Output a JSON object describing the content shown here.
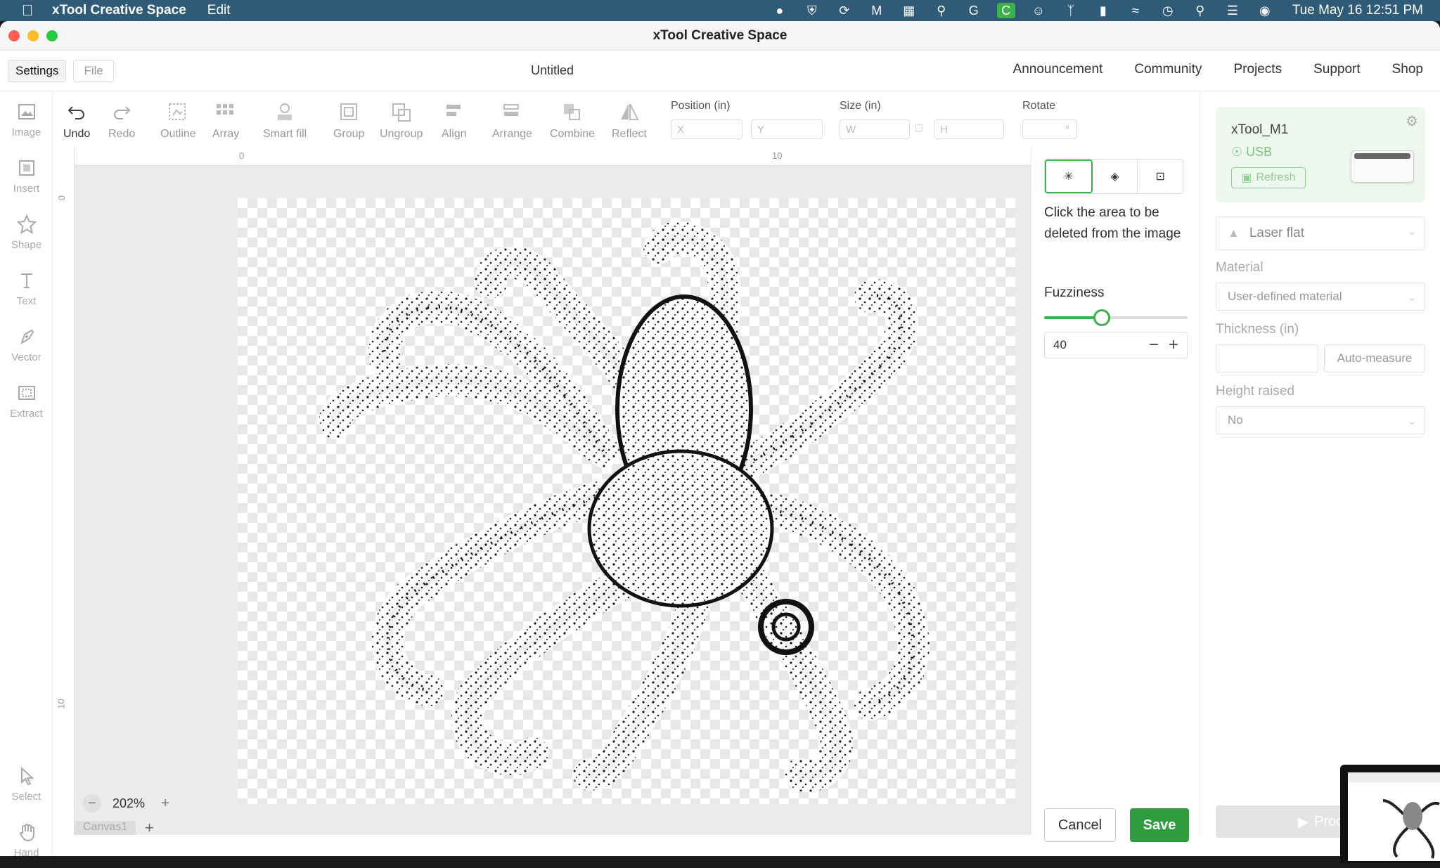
{
  "menubar": {
    "app_name": "xTool Creative Space",
    "menu_edit": "Edit",
    "clock": "Tue May 16  12:51 PM"
  },
  "window": {
    "title": "xTool Creative Space"
  },
  "topnav": {
    "settings": "Settings",
    "file": "File",
    "doc_title": "Untitled",
    "links": [
      "Announcement",
      "Community",
      "Projects",
      "Support",
      "Shop"
    ]
  },
  "leftbar": {
    "tools": [
      "Image",
      "Insert",
      "Shape",
      "Text",
      "Vector",
      "Extract"
    ],
    "select": "Select",
    "hand": "Hand"
  },
  "toolbar": {
    "undo": "Undo",
    "redo": "Redo",
    "outline": "Outline",
    "array": "Array",
    "smart_fill": "Smart fill",
    "group": "Group",
    "ungroup": "Ungroup",
    "align": "Align",
    "arrange": "Arrange",
    "combine": "Combine",
    "reflect": "Reflect",
    "position_label": "Position (in)",
    "pos_x": "X",
    "pos_y": "Y",
    "size_label": "Size (in)",
    "size_w": "W",
    "size_h": "H",
    "rotate_label": "Rotate",
    "rotate_unit": "°"
  },
  "canvas": {
    "ruler_0": "0",
    "ruler_10": "10",
    "zoom": "202%",
    "tab": "Canvas1"
  },
  "erase_panel": {
    "instruction": "Click the area to be deleted from the image",
    "fuzziness_label": "Fuzziness",
    "fuzziness_value": "40",
    "fuzziness_fraction": 0.4,
    "cancel": "Cancel",
    "save": "Save"
  },
  "right_panel": {
    "device_name": "xTool_M1",
    "connection": "USB",
    "refresh": "Refresh",
    "mode": "Laser flat",
    "material_label": "Material",
    "material_value": "User-defined material",
    "thickness_label": "Thickness (in)",
    "auto_measure": "Auto-measure",
    "height_label": "Height raised",
    "height_value": "No",
    "process": "Proc"
  },
  "colors": {
    "menubar": "#2f5a78",
    "accent": "#3db04b",
    "save": "#2f9d3f"
  }
}
